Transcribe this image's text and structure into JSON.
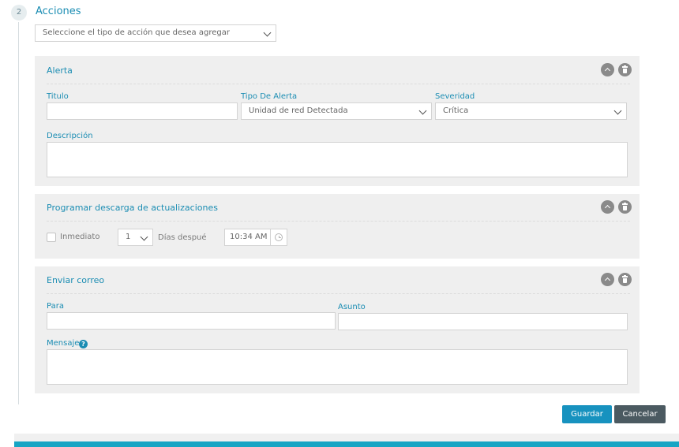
{
  "step": {
    "number": "2",
    "title": "Acciones",
    "action_select_placeholder": "Seleccione el tipo de acción que desea agregar"
  },
  "alerta": {
    "title": "Alerta",
    "titulo_label": "Titulo",
    "titulo_value": "",
    "tipo_label": "Tipo De Alerta",
    "tipo_value": "Unidad de red Detectada",
    "severidad_label": "Severidad",
    "severidad_value": "Crítica",
    "descripcion_label": "Descripción",
    "descripcion_value": ""
  },
  "programar": {
    "title": "Programar descarga de actualizaciones",
    "inmediato_label": "Inmediato",
    "inmediato_checked": false,
    "days_value": "1",
    "dias_label": "Días despué",
    "time_value": "10:34 AM"
  },
  "correo": {
    "title": "Enviar correo",
    "para_label": "Para",
    "para_value": "",
    "asunto_label": "Asunto",
    "asunto_value": "",
    "mensaje_label": "Mensaje",
    "help_icon": "?",
    "mensaje_value": ""
  },
  "buttons": {
    "save": "Guardar",
    "cancel": "Cancelar"
  },
  "icons": {
    "collapse": "chevron-up-icon",
    "delete": "trash-icon",
    "clock": "clock-icon",
    "help": "question-circle-icon"
  },
  "colors": {
    "accent": "#1b8db3",
    "save_button": "#1792bf",
    "cancel_button": "#4b5a61",
    "footer_bar": "#16a5c4",
    "panel_bg": "#efefef"
  }
}
